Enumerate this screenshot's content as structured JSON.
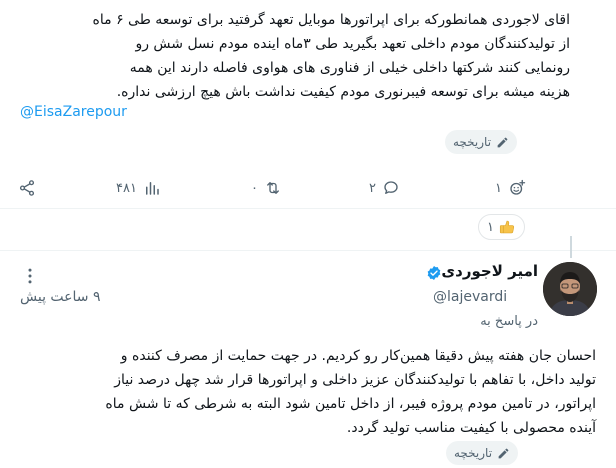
{
  "post": {
    "lines": [
      "اقای لاجوردی همانطورکه برای اپراتورها موبایل تعهد گرفتید برای توسعه طی ۶ ماه",
      "از تولیدکنندگان مودم داخلی تعهد بگیرید طی ۳ماه اینده مودم نسل شش رو",
      "رونمایی کنند شرکتها داخلی خیلی از فناوری های هواوی فاصله دارند این همه",
      "هزینه میشه برای توسعه فیبرنوری مودم کیفیت نداشت باش هیچ ارزشی نداره."
    ],
    "mention": "@EisaZarepour",
    "history_label": "تاریخچه"
  },
  "actions": {
    "reactions_count": "۱",
    "reply_count": "۲",
    "retweet_count": "۰",
    "views_count": "۴۸۱"
  },
  "like_count": "۱",
  "reply": {
    "author_name": "امیر لاجوردی",
    "handle": "@lajevardi",
    "time": "۹ ساعت پیش",
    "reply_to": "در پاسخ به",
    "lines": [
      "احسان جان هفته پیش دقیقا همین‌کار رو کردیم. در جهت حمایت از مصرف کننده و",
      "تولید داخل، با تفاهم با تولیدکنندگان عزیز داخلی و اپراتورها قرار شد چهل درصد نیاز",
      "اپراتور، در تامین مودم پروژه فیبر، از داخل تامین شود البته به شرطی که تا شش ماه",
      "آینده محصولی با کیفیت مناسب تولید گردد."
    ],
    "history_label": "تاریخچه"
  },
  "colors": {
    "accent": "#1d9bf0",
    "text": "#0f1419",
    "muted": "#536471"
  }
}
